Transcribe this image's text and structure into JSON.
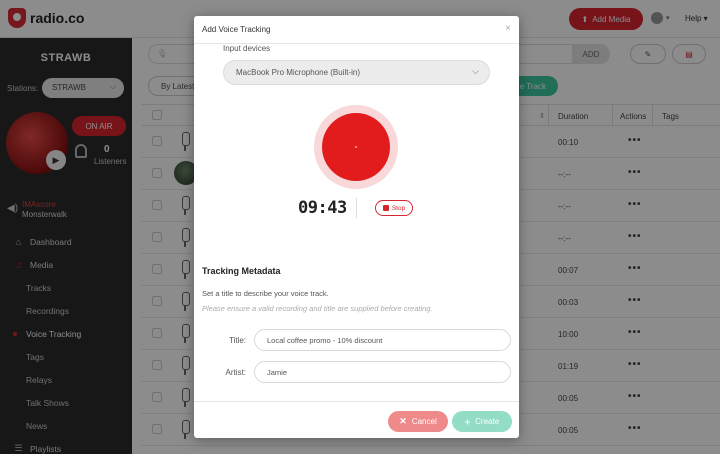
{
  "topbar": {
    "logo_text": "radio.co",
    "add_media_label": "Add Media",
    "help_label": "Help"
  },
  "sidebar": {
    "station_name": "STRAWB",
    "stations_label": "Stations:",
    "stations_value": "STRAWB",
    "on_air_label": "ON AIR",
    "listeners_count": "0",
    "listeners_label": "Listeners",
    "now_playing": {
      "title": "IMAscore",
      "artist": "Monsterwalk"
    },
    "nav": [
      {
        "label": "Dashboard",
        "icon": "home-icon"
      },
      {
        "label": "Media",
        "icon": "music-icon"
      },
      {
        "label": "Tracks"
      },
      {
        "label": "Recordings"
      },
      {
        "label": "Voice Tracking"
      },
      {
        "label": "Tags"
      },
      {
        "label": "Relays"
      },
      {
        "label": "Talk Shows"
      },
      {
        "label": "News"
      },
      {
        "label": "Playlists",
        "icon": "list-icon"
      }
    ]
  },
  "main": {
    "add_label": "ADD",
    "sort_label": "By Latest",
    "track_button_label": "e Track",
    "columns": {
      "duration": "Duration",
      "actions": "Actions",
      "tags": "Tags"
    },
    "rows": [
      {
        "duration": "00:10",
        "actions": "•••",
        "thumb": false
      },
      {
        "duration": "--:--",
        "actions": "•••",
        "thumb": true
      },
      {
        "duration": "--:--",
        "actions": "•••",
        "thumb": false
      },
      {
        "duration": "--:--",
        "actions": "•••",
        "thumb": false
      },
      {
        "duration": "00:07",
        "actions": "•••",
        "thumb": false
      },
      {
        "duration": "00:03",
        "actions": "•••",
        "thumb": false
      },
      {
        "duration": "10:00",
        "actions": "•••",
        "thumb": false
      },
      {
        "duration": "01:19",
        "actions": "•••",
        "thumb": false
      },
      {
        "duration": "00:05",
        "actions": "•••",
        "thumb": false
      },
      {
        "duration": "00:05",
        "actions": "•••",
        "thumb": false
      }
    ]
  },
  "modal": {
    "title": "Add Voice Tracking",
    "close_symbol": "×",
    "input_devices_label": "Input devices",
    "input_device_value": "MacBook Pro Microphone (Built-in)",
    "timer": "09:43",
    "stop_label": "Stop",
    "metadata_heading": "Tracking Metadata",
    "metadata_description": "Set a title to describe your voice track.",
    "metadata_note": "Please ensure a valid recording and title are supplied before creating.",
    "title_label": "Title:",
    "title_value": "Local coffee promo - 10% discount",
    "artist_label": "Artist:",
    "artist_value": "Jamie",
    "cancel_label": "Cancel",
    "create_label": "Create",
    "colors": {
      "record": "#e21c1c",
      "cancel": "#ef8a8a",
      "create": "#93dcc5",
      "brand_red": "#d7262f"
    }
  }
}
